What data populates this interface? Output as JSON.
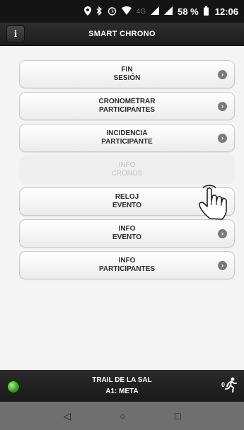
{
  "status_bar": {
    "battery": "58 %",
    "time": "12:06",
    "network": "4G",
    "icons": [
      "location-icon",
      "bluetooth-icon",
      "alarm-icon",
      "wifi-icon",
      "signal-icon",
      "signal-icon",
      "battery-icon"
    ]
  },
  "header": {
    "title": "SMART CHRONO",
    "info_label": "i"
  },
  "menu": [
    {
      "label": "FIN\nSESIÓN",
      "enabled": true
    },
    {
      "label": "CRONOMETRAR\nPARTICIPANTES",
      "enabled": true
    },
    {
      "label": "INCIDENCIA\nPARTICIPANTE",
      "enabled": true
    },
    {
      "label": "INFO\nCRONOS",
      "enabled": false
    },
    {
      "label": "RELOJ\nEVENTO",
      "enabled": true
    },
    {
      "label": "INFO\nEVENTO",
      "enabled": true
    },
    {
      "label": "INFO\nPARTICIPANTES",
      "enabled": true
    }
  ],
  "footer": {
    "event_name": "TRAIL DE LA SAL",
    "checkpoint": "A1: META",
    "runner_count": "0",
    "status_color": "#3aa020"
  },
  "navigation": {
    "back": "◁",
    "home": "○",
    "recents": "□"
  },
  "colors": {
    "header_bg": "#222222",
    "accent_green": "#3aa020",
    "button_bg": "#f5f5f5",
    "chevron": "#7a7a7a"
  }
}
